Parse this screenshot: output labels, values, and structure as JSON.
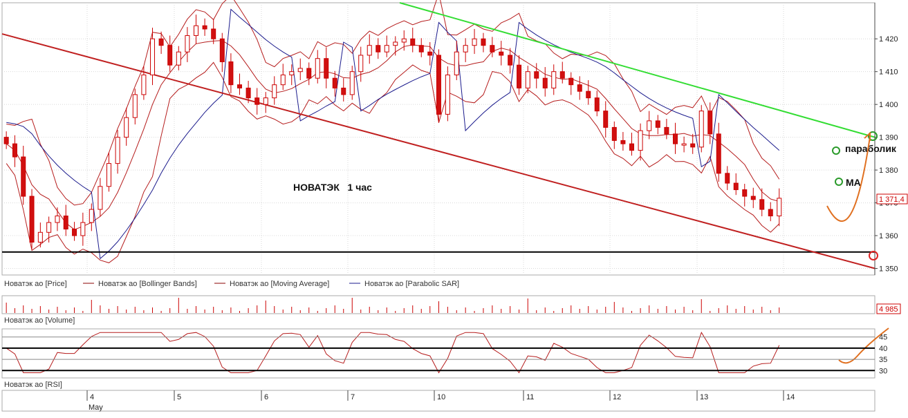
{
  "chart_data": {
    "type": "candlestick",
    "title": "НОВАТЭК   1 час",
    "price_axis": {
      "range": [
        1348,
        1431
      ],
      "ticks": [
        1350,
        1360,
        1370,
        1380,
        1390,
        1400,
        1410,
        1420
      ],
      "tick_labels": [
        "1 350",
        "1 360",
        "1 370",
        "1 380",
        "1 390",
        "1 400",
        "1 410",
        "1 420"
      ]
    },
    "current_price_label": "1 371,4",
    "volume_label": "4 985",
    "rsi_axis": {
      "ticks": [
        45,
        40,
        35,
        30
      ],
      "tick_labels": [
        "45",
        "40",
        "35",
        "30"
      ],
      "range": [
        27,
        48
      ]
    },
    "x_axis": {
      "days": [
        "4",
        "5",
        "6",
        "7",
        "10",
        "11",
        "12",
        "13",
        "14"
      ],
      "month": "May"
    },
    "legend": [
      {
        "name": "Новатэк ао [Price]",
        "color": "#8b0000"
      },
      {
        "name": "Новатэк ао [Bollinger Bands]",
        "color": "#8b0000"
      },
      {
        "name": "Новатэк ао [Moving Average]",
        "color": "#8b0000"
      },
      {
        "name": "Новатэк ао [Parabolic SAR]",
        "color": "#1a1a8c"
      }
    ],
    "panel_labels": {
      "volume": "Новатэк ао [Volume]",
      "rsi": "Новатэк ао [RSI]"
    },
    "annotations": {
      "parabolic": "параболик",
      "ma": "MA"
    },
    "day_closes": [
      [
        1388,
        1384,
        1372,
        1358,
        1361,
        1364,
        1366,
        1362,
        1360,
        1364
      ],
      [
        1368,
        1375,
        1382,
        1390,
        1396,
        1403,
        1409,
        1420,
        1418,
        1412
      ],
      [
        1416,
        1421,
        1424,
        1423,
        1420,
        1413,
        1406,
        1405,
        1402,
        1400
      ],
      [
        1402,
        1406,
        1409,
        1410,
        1411,
        1408,
        1414,
        1408,
        1405,
        1403
      ],
      [
        1410,
        1415,
        1418,
        1416,
        1418,
        1419,
        1420,
        1418,
        1416,
        1415
      ],
      [
        1397,
        1409,
        1416,
        1418,
        1420,
        1418,
        1416,
        1415,
        1412,
        1405
      ],
      [
        1410,
        1408,
        1405,
        1410,
        1408,
        1406,
        1404,
        1402,
        1398,
        1393
      ],
      [
        1389,
        1388,
        1386,
        1392,
        1395,
        1393,
        1391,
        1388,
        1388,
        1387
      ],
      [
        1398,
        1391,
        1379,
        1376,
        1374,
        1372,
        1371,
        1368,
        1366,
        1371.4
      ]
    ],
    "price_lines": {
      "horizontal_support": 1355,
      "rising_green_end": 1390,
      "falling_red_end": 1350
    }
  }
}
